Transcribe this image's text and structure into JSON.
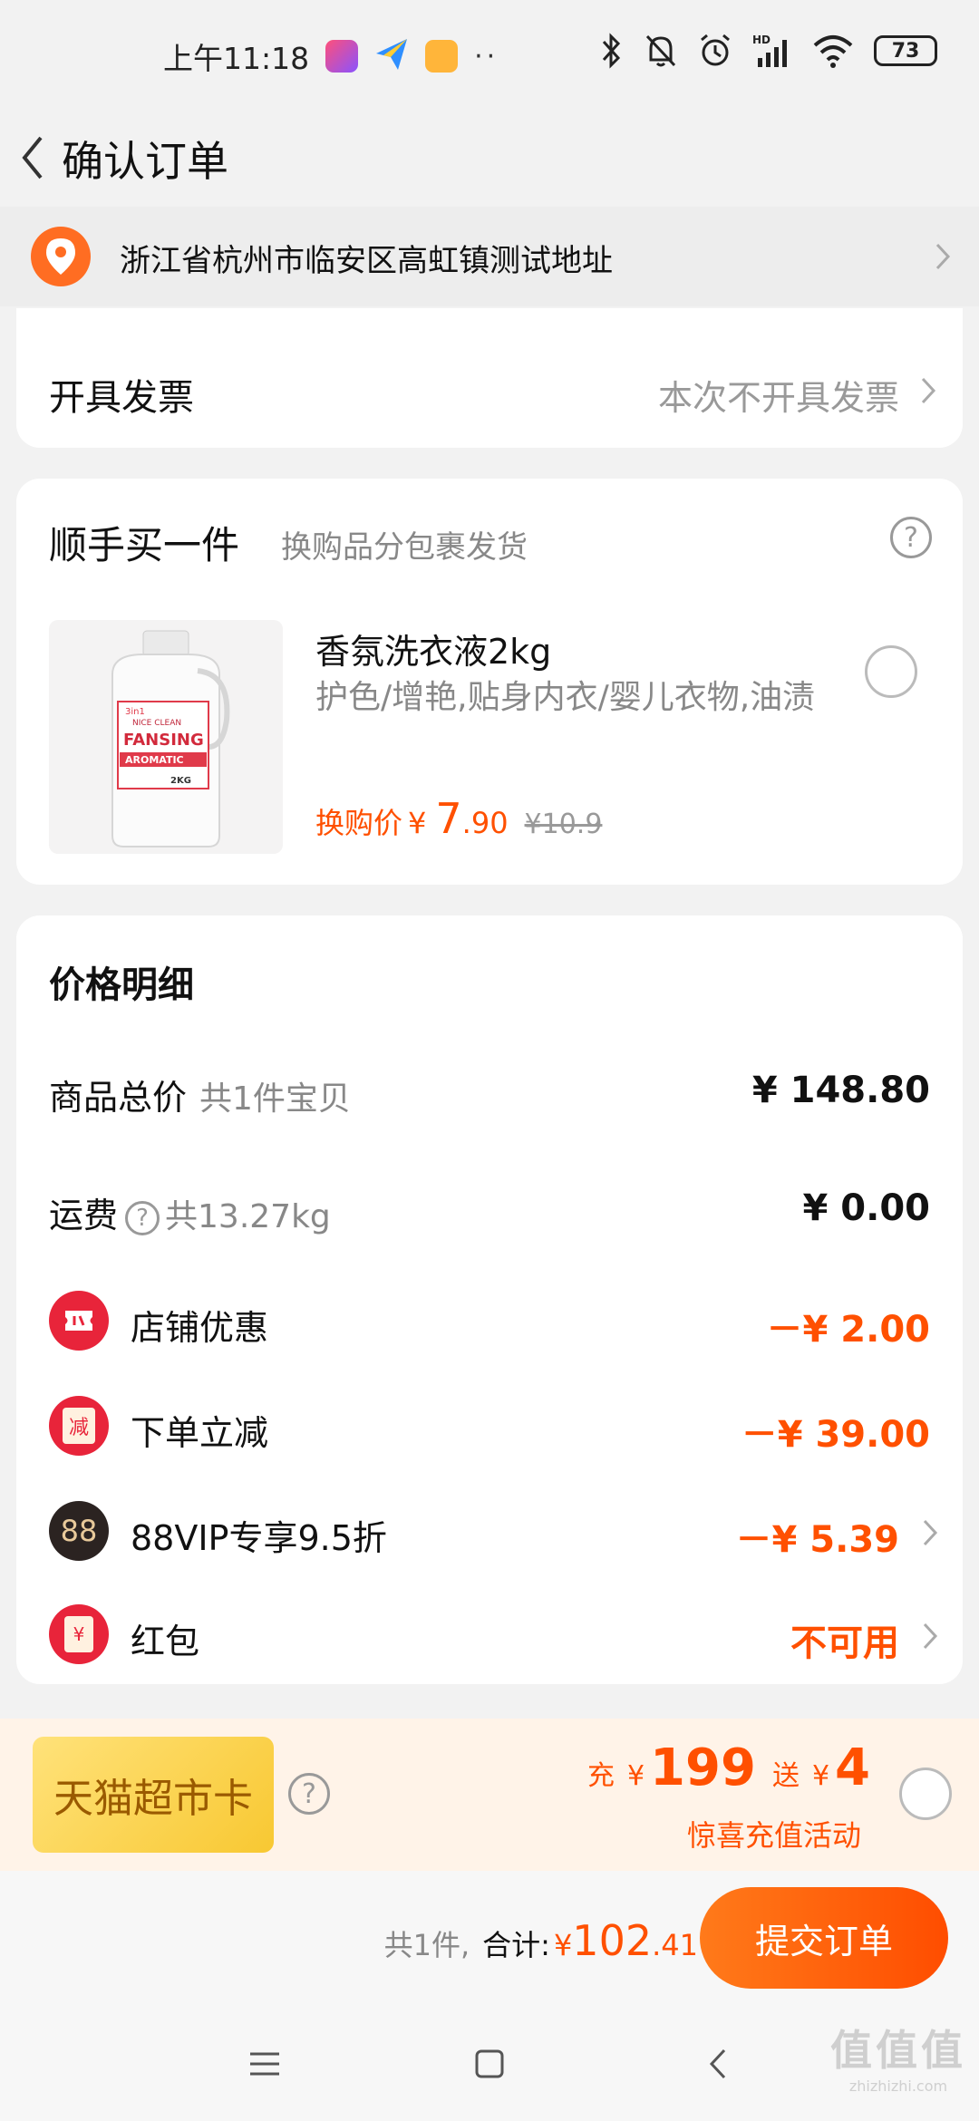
{
  "status_bar": {
    "time": "上午11:18",
    "battery": "73",
    "network": "HD",
    "dots": "··"
  },
  "header": {
    "title": "确认订单"
  },
  "address": {
    "text": "浙江省杭州市临安区高虹镇测试地址"
  },
  "invoice": {
    "label": "开具发票",
    "value": "本次不开具发票"
  },
  "addon": {
    "title": "顺手买一件",
    "subtitle": "换购品分包裹发货",
    "product": {
      "name": "香氛洗衣液2kg",
      "description": "护色/增艳,贴身内衣/婴儿衣物,油渍",
      "price_label": "换购价",
      "currency": "¥",
      "price_int": "7",
      "price_dec": ".90",
      "original_price": "¥10.9",
      "image_text": {
        "brand": "FANSING",
        "line1": "NICE CLEAN",
        "line2": "AROMATIC",
        "size": "2KG",
        "badge": "3in1"
      }
    }
  },
  "price_detail": {
    "title": "价格明细",
    "rows": [
      {
        "label": "商品总价",
        "sub": "共1件宝贝",
        "value": "¥ 148.80"
      },
      {
        "label": "运费",
        "sub": "共13.27kg",
        "value": "¥ 0.00"
      },
      {
        "label": "店铺优惠",
        "value": "－¥ 2.00"
      },
      {
        "label": "下单立减",
        "value": "－¥ 39.00",
        "icon_text": "减"
      },
      {
        "label": "88VIP专享9.5折",
        "value": "－¥ 5.39",
        "icon_text": "88"
      },
      {
        "label": "红包",
        "value": "不可用",
        "icon_text": "¥"
      }
    ]
  },
  "tmall_card": {
    "name": "天猫超市卡",
    "recharge_prefix": "充",
    "currency": "¥",
    "recharge_amount": "199",
    "bonus_prefix": "送",
    "bonus_amount": "4",
    "caption": "惊喜充值活动"
  },
  "bottom_bar": {
    "count": "共1件,",
    "total_label": "合计:",
    "currency": "¥",
    "total_int": "102",
    "total_dec": ".41",
    "submit_label": "提交订单"
  },
  "watermark": {
    "main": "值值值",
    "sub": "zhizhizhi.com"
  },
  "colors": {
    "accent": "#ff5000",
    "location_icon": "#ff6d22",
    "shop_icon": "#e8243a",
    "vip_icon": "#2b2321"
  }
}
